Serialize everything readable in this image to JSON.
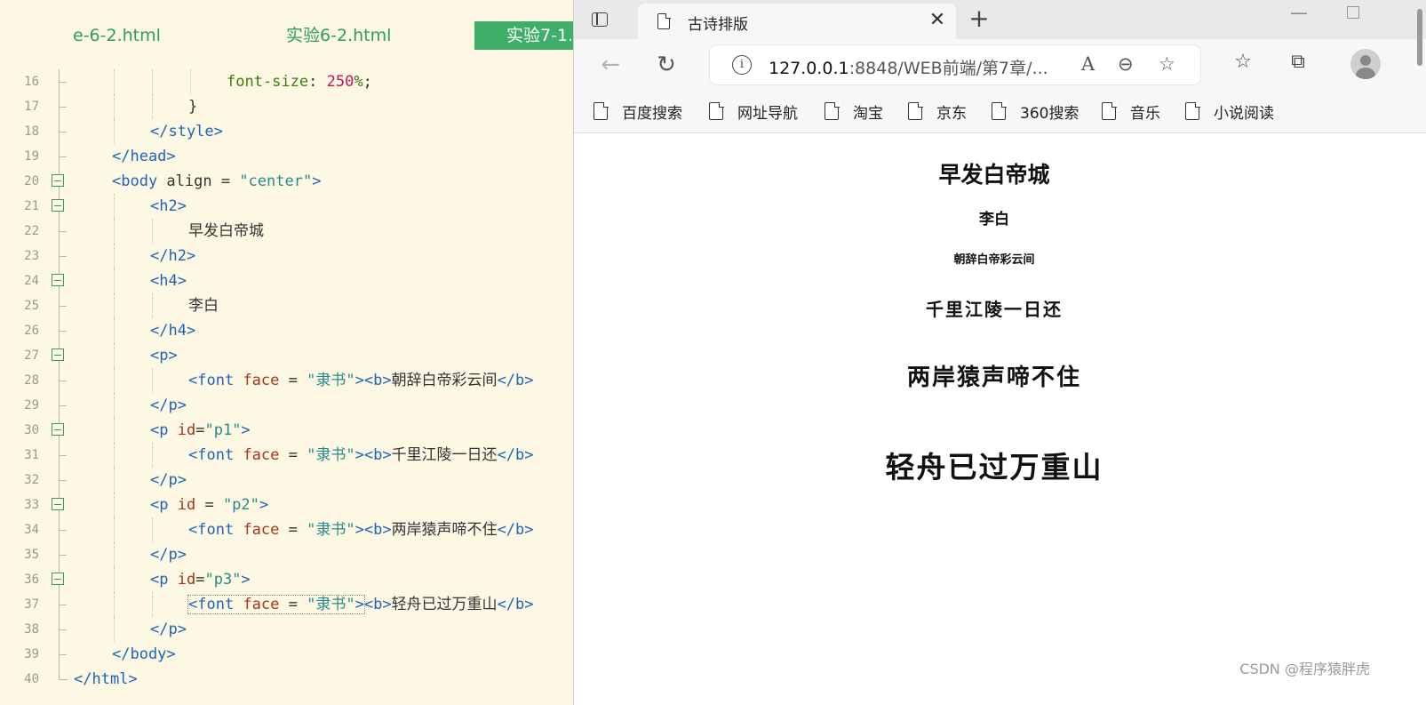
{
  "editor": {
    "tabs": [
      "e-6-2.html",
      "实验6-2.html",
      "实验7-1."
    ],
    "active_tab": 2
  },
  "code_lines": [
    {
      "n": "16",
      "indent": 6,
      "parts": [
        [
          "prop",
          "font-size"
        ],
        [
          "plain",
          ": "
        ],
        [
          "num",
          "250"
        ],
        [
          "prop",
          "%"
        ],
        [
          "plain",
          ";"
        ]
      ]
    },
    {
      "n": "17",
      "indent": 5,
      "parts": [
        [
          "plain",
          "}"
        ]
      ]
    },
    {
      "n": "18",
      "indent": 4,
      "parts": [
        [
          "tag",
          "</style>"
        ]
      ]
    },
    {
      "n": "19",
      "indent": 3,
      "parts": [
        [
          "tag",
          "</head>"
        ]
      ]
    },
    {
      "n": "20",
      "indent": 3,
      "fold": true,
      "parts": [
        [
          "tag",
          "<body"
        ],
        [
          "plain",
          " align = "
        ],
        [
          "str",
          "\"center\""
        ],
        [
          "tag",
          ">"
        ]
      ]
    },
    {
      "n": "21",
      "indent": 4,
      "fold": true,
      "parts": [
        [
          "tag",
          "<h2>"
        ]
      ]
    },
    {
      "n": "22",
      "indent": 5,
      "parts": [
        [
          "plain",
          "早发白帝城"
        ]
      ]
    },
    {
      "n": "23",
      "indent": 4,
      "parts": [
        [
          "tag",
          "</h2>"
        ]
      ]
    },
    {
      "n": "24",
      "indent": 4,
      "fold": true,
      "parts": [
        [
          "tag",
          "<h4>"
        ]
      ]
    },
    {
      "n": "25",
      "indent": 5,
      "parts": [
        [
          "plain",
          "李白"
        ]
      ]
    },
    {
      "n": "26",
      "indent": 4,
      "parts": [
        [
          "tag",
          "</h4>"
        ]
      ]
    },
    {
      "n": "27",
      "indent": 4,
      "fold": true,
      "parts": [
        [
          "tag",
          "<p>"
        ]
      ]
    },
    {
      "n": "28",
      "indent": 5,
      "parts": [
        [
          "tag",
          "<font"
        ],
        [
          "plain",
          " "
        ],
        [
          "attr",
          "face"
        ],
        [
          "plain",
          " = "
        ],
        [
          "str",
          "\"隶书\""
        ],
        [
          "tag",
          ">"
        ],
        [
          "tag",
          "<b>"
        ],
        [
          "plain",
          "朝辞白帝彩云间"
        ],
        [
          "tag",
          "</b>"
        ]
      ]
    },
    {
      "n": "29",
      "indent": 4,
      "parts": [
        [
          "tag",
          "</p>"
        ]
      ]
    },
    {
      "n": "30",
      "indent": 4,
      "fold": true,
      "parts": [
        [
          "tag",
          "<p"
        ],
        [
          "plain",
          " "
        ],
        [
          "attr",
          "id"
        ],
        [
          "plain",
          "="
        ],
        [
          "str",
          "\"p1\""
        ],
        [
          "tag",
          ">"
        ]
      ]
    },
    {
      "n": "31",
      "indent": 5,
      "parts": [
        [
          "tag",
          "<font"
        ],
        [
          "plain",
          " "
        ],
        [
          "attr",
          "face"
        ],
        [
          "plain",
          " = "
        ],
        [
          "str",
          "\"隶书\""
        ],
        [
          "tag",
          ">"
        ],
        [
          "tag",
          "<b>"
        ],
        [
          "plain",
          "千里江陵一日还"
        ],
        [
          "tag",
          "</b>"
        ]
      ]
    },
    {
      "n": "32",
      "indent": 4,
      "parts": [
        [
          "tag",
          "</p>"
        ]
      ]
    },
    {
      "n": "33",
      "indent": 4,
      "fold": true,
      "parts": [
        [
          "tag",
          "<p"
        ],
        [
          "plain",
          " "
        ],
        [
          "attr",
          "id"
        ],
        [
          "plain",
          " = "
        ],
        [
          "str",
          "\"p2\""
        ],
        [
          "tag",
          ">"
        ]
      ]
    },
    {
      "n": "34",
      "indent": 5,
      "parts": [
        [
          "tag",
          "<font"
        ],
        [
          "plain",
          " "
        ],
        [
          "attr",
          "face"
        ],
        [
          "plain",
          " = "
        ],
        [
          "str",
          "\"隶书\""
        ],
        [
          "tag",
          ">"
        ],
        [
          "tag",
          "<b>"
        ],
        [
          "plain",
          "两岸猿声啼不住"
        ],
        [
          "tag",
          "</b>"
        ]
      ]
    },
    {
      "n": "35",
      "indent": 4,
      "parts": [
        [
          "tag",
          "</p>"
        ]
      ]
    },
    {
      "n": "36",
      "indent": 4,
      "fold": true,
      "parts": [
        [
          "tag",
          "<p"
        ],
        [
          "plain",
          " "
        ],
        [
          "attr",
          "id"
        ],
        [
          "plain",
          "="
        ],
        [
          "str",
          "\"p3\""
        ],
        [
          "tag",
          ">"
        ]
      ]
    },
    {
      "n": "37",
      "indent": 5,
      "highlight": true,
      "parts": [
        [
          "tag",
          "<font"
        ],
        [
          "plain",
          " "
        ],
        [
          "attr",
          "face"
        ],
        [
          "plain",
          " = "
        ],
        [
          "str",
          "\"隶书\""
        ],
        [
          "tag",
          ">"
        ],
        [
          "tag",
          "<b>"
        ],
        [
          "plain",
          "轻舟已过万重山"
        ],
        [
          "tag",
          "</b>"
        ]
      ]
    },
    {
      "n": "38",
      "indent": 4,
      "parts": [
        [
          "tag",
          "</p>"
        ]
      ]
    },
    {
      "n": "39",
      "indent": 3,
      "parts": [
        [
          "tag",
          "</body>"
        ]
      ]
    },
    {
      "n": "40",
      "indent": 2,
      "last": true,
      "parts": [
        [
          "tag",
          "</html>"
        ]
      ]
    }
  ],
  "browser": {
    "tab_title": "古诗排版",
    "tab_close": "✕",
    "new_tab": "+",
    "win_min": "—",
    "url_host": "127.0.0.1",
    "url_rest": ":8848/WEB前端/第7章/...",
    "read_icon": "A",
    "zoom_icon": "⊖",
    "fav_add_icon": "☆",
    "back": "←",
    "reload": "↻",
    "favorites_icon": "☆",
    "collections_icon": "⧉",
    "bookmarks": [
      "百度搜索",
      "网址导航",
      "淘宝",
      "京东",
      "360搜索",
      "音乐",
      "小说阅读"
    ]
  },
  "page": {
    "title": "早发白帝城",
    "author": "李白",
    "line1": "朝辞白帝彩云间",
    "line2": "千里江陵一日还",
    "line3": "两岸猿声啼不住",
    "line4": "轻舟已过万重山"
  },
  "watermark": "CSDN @程序猿胖虎",
  "colors": {
    "editor_bg": "#fdf8e4",
    "active_tab_bg": "#3fae68",
    "tag": "#1f63b8",
    "attribute": "#a8321a",
    "string": "#2a8a8a"
  }
}
